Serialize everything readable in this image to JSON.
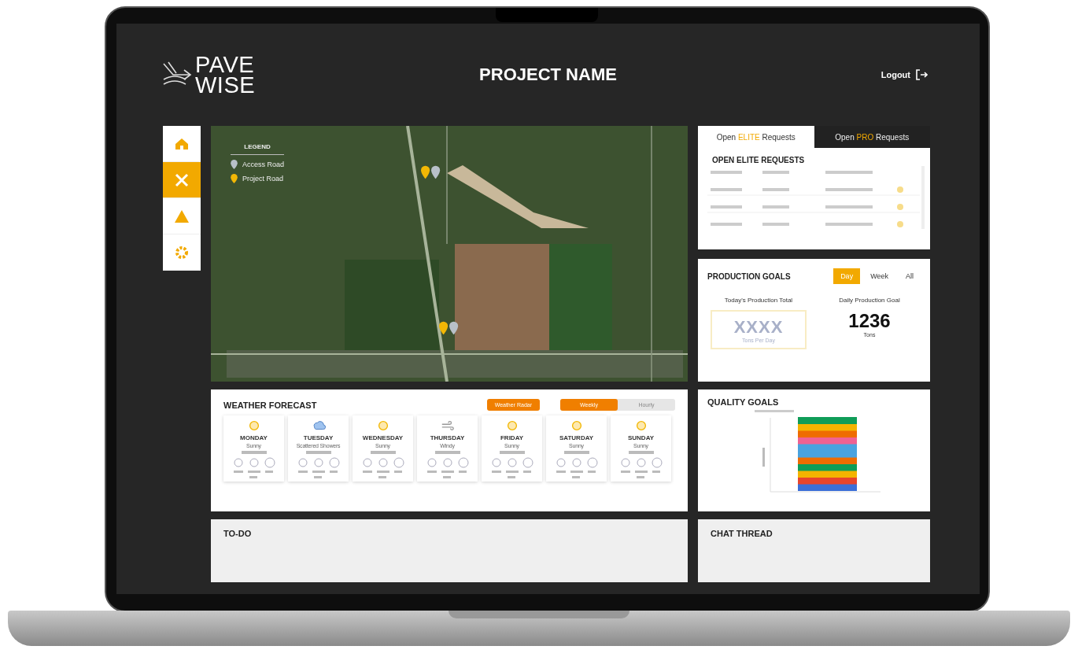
{
  "header": {
    "logo_top": "PAVE",
    "logo_bottom": "WISE",
    "title": "PROJECT NAME",
    "logout": "Logout"
  },
  "sidebar": {
    "items": [
      {
        "kind": "home",
        "selected": false
      },
      {
        "kind": "tools",
        "selected": true
      },
      {
        "kind": "warning",
        "selected": false
      },
      {
        "kind": "gear",
        "selected": false
      }
    ]
  },
  "map": {
    "legend": {
      "title": "LEGEND",
      "items": [
        {
          "label": "Access Road",
          "color": "#b8c0c8"
        },
        {
          "label": "Project Road",
          "color": "#f2b705"
        }
      ]
    }
  },
  "requests": {
    "tabs": [
      {
        "before": "Open ",
        "highlight": "ELITE",
        "after": " Requests",
        "selected": true
      },
      {
        "before": "Open ",
        "highlight": "PRO",
        "after": " Requests",
        "selected": false
      }
    ],
    "heading": "OPEN ELITE REQUESTS"
  },
  "production": {
    "title": "PRODUCTION GOALS",
    "periods": [
      {
        "label": "Day",
        "selected": true
      },
      {
        "label": "Week",
        "selected": false
      },
      {
        "label": "All",
        "selected": false
      }
    ],
    "total_label": "Today's Production Total",
    "total_value": "XXXX",
    "total_unit": "Tons Per Day",
    "goal_label": "Daily Production Goal",
    "goal_value": "1236",
    "goal_unit": "Tons"
  },
  "weather": {
    "title": "WEATHER FORECAST",
    "radar_button": "Weather Radar",
    "views": [
      {
        "label": "Weekly",
        "selected": true
      },
      {
        "label": "Hourly",
        "selected": false
      }
    ],
    "days": [
      {
        "day": "MONDAY",
        "condition": "Sunny",
        "kind": "sun"
      },
      {
        "day": "TUESDAY",
        "condition": "Scattered Showers",
        "kind": "showers"
      },
      {
        "day": "WEDNESDAY",
        "condition": "Sunny",
        "kind": "sun"
      },
      {
        "day": "THURSDAY",
        "condition": "Windy",
        "kind": "wind"
      },
      {
        "day": "FRIDAY",
        "condition": "Sunny",
        "kind": "sun"
      },
      {
        "day": "SATURDAY",
        "condition": "Sunny",
        "kind": "sun"
      },
      {
        "day": "SUNDAY",
        "condition": "Sunny",
        "kind": "sun"
      }
    ]
  },
  "quality": {
    "title": "QUALITY GOALS"
  },
  "todo": {
    "title": "TO-DO"
  },
  "chat": {
    "title": "CHAT THREAD"
  }
}
